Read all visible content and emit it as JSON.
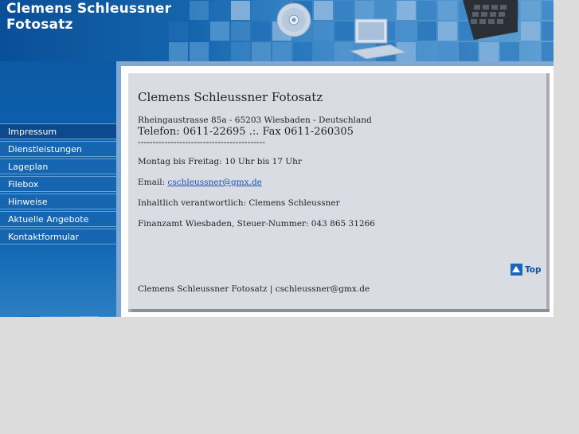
{
  "header": {
    "title_line1": "Clemens Schleussner",
    "title_line2": "Fotosatz"
  },
  "nav": {
    "items": [
      {
        "label": "Impressum",
        "active": true
      },
      {
        "label": "Dienstleistungen",
        "active": false
      },
      {
        "label": "Lageplan",
        "active": false
      },
      {
        "label": "Filebox",
        "active": false
      },
      {
        "label": "Hinweise",
        "active": false
      },
      {
        "label": "Aktuelle Angebote",
        "active": false
      },
      {
        "label": "Kontaktformular",
        "active": false
      }
    ]
  },
  "content": {
    "company": "Clemens Schleussner Fotosatz",
    "address": "Rheingaustrasse 85a - 65203 Wiesbaden - Deutschland",
    "phone": "Telefon: 0611-22695 .:. Fax 0611-260305",
    "divider": "-------------------------------------------",
    "hours": "Montag bis Freitag: 10 Uhr bis 17 Uhr",
    "email_label": "Email: ",
    "email": "cschleussner@gmx.de",
    "responsible": "Inhaltlich verantwortlich: Clemens Schleussner",
    "tax": "Finanzamt Wiesbaden, Steuer-Nummer: 043 865 31266",
    "top_label": "Top",
    "footer": "Clemens Schleussner Fotosatz | cschleussner@gmx.de"
  },
  "colors": {
    "header_blue": "#0a4f97",
    "nav_blue": "#1565b1",
    "nav_active": "#0d4a8d",
    "content_bg": "#d9dde3",
    "page_bg": "#dcdcdc"
  },
  "icons": [
    "cd-icon",
    "monitor-icon",
    "keyboard-icon",
    "top-arrow-icon"
  ]
}
